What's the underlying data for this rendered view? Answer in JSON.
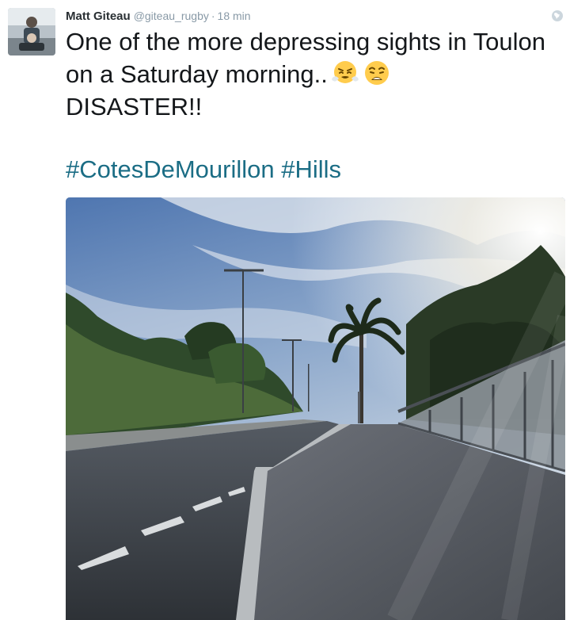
{
  "tweet": {
    "author_name": "Matt Giteau",
    "handle": "@giteau_rugby",
    "separator": "·",
    "timestamp": "18 min",
    "text_line": "One of the more depressing sights in Toulon on a Saturday morning..",
    "text_tail": "DISASTER!!",
    "emojis": [
      "face-with-steam-icon",
      "weary-face-icon"
    ],
    "hashtags": [
      "#CotesDeMourillon",
      "#Hills"
    ],
    "globe_icon": "globe-icon"
  },
  "colors": {
    "hashtag": "#1b6d85",
    "name": "#292f33",
    "meta": "#8899a6"
  }
}
